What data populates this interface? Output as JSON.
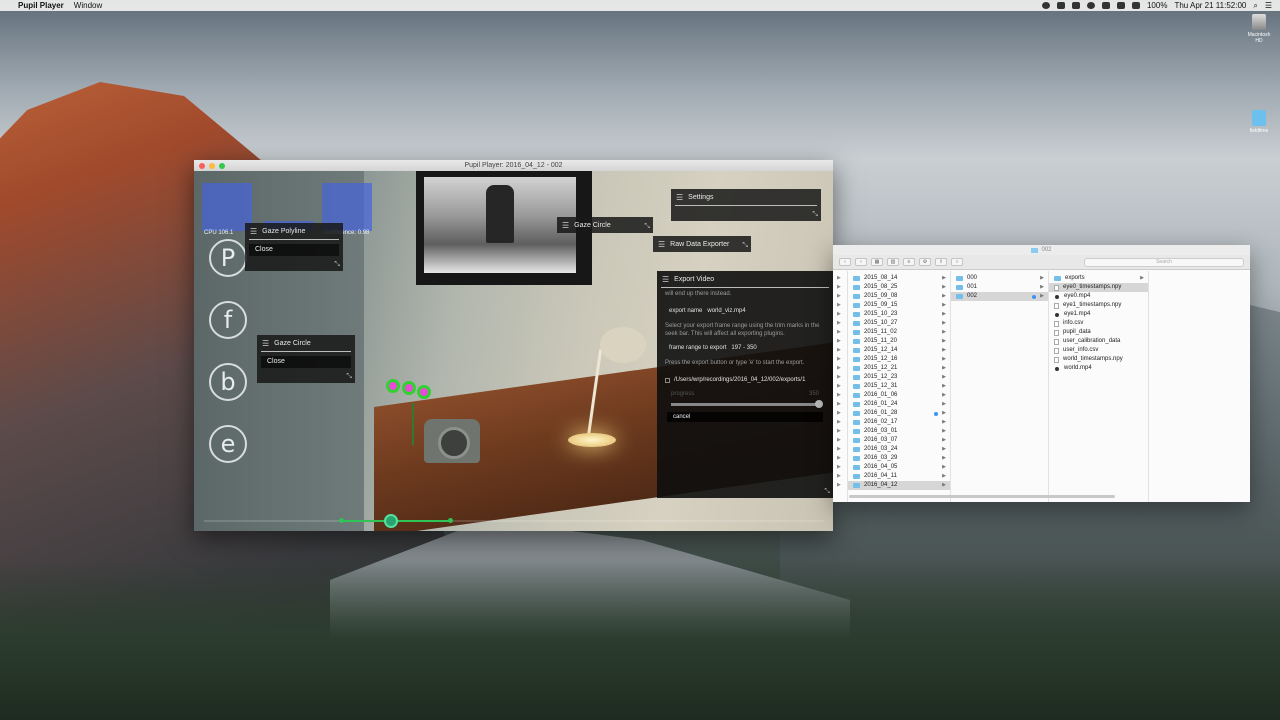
{
  "menubar": {
    "apple": "",
    "app_name": "Pupil Player",
    "items": [
      "Window"
    ],
    "battery": "100%",
    "datetime": "Thu Apr 21  11:52:00"
  },
  "desktop": {
    "hd_label": "Macintosh HD",
    "folder_label": "fieldtime"
  },
  "player": {
    "title": "Pupil Player: 2016_04_12 - 002",
    "cpu_label": "CPU 106.1",
    "conf_label": "Confidence: 0.98",
    "round_buttons": [
      "P",
      "f",
      "b",
      "e"
    ],
    "gaze_polyline": {
      "title": "Gaze Polyline",
      "close": "Close"
    },
    "gaze_circle_1": {
      "title": "Gaze Circle",
      "close": "Close"
    },
    "gaze_circle_2": {
      "title": "Gaze Circle"
    },
    "settings": {
      "title": "Settings"
    },
    "raw_data": {
      "title": "Raw Data Exporter"
    },
    "export_video": {
      "title": "Export Video",
      "trailing_text": "will end up there instead.",
      "export_name_label": "export name",
      "export_name_value": "world_viz.mp4",
      "hint": "Select your export frame range using the trim marks in the seek bar. This will affect all exporting plugins.",
      "frame_range_label": "frame range to export",
      "frame_range_value": "197 - 350",
      "press_hint": "Press the export button or type 'e' to start the export.",
      "path": "/Users/wrp/recordings/2016_04_12/002/exports/1",
      "progress_label": "progress",
      "progress_value": "350",
      "progress_fraction": 1.0,
      "cancel": "cancel"
    }
  },
  "finder": {
    "title": "002",
    "search_placeholder": "Search",
    "col1": [
      "2015_08_14",
      "2015_08_25",
      "2015_09_08",
      "2015_09_15",
      "2015_10_23",
      "2015_10_27",
      "2015_11_02",
      "2015_11_20",
      "2015_12_14",
      "2015_12_16",
      "2015_12_21",
      "2015_12_23",
      "2015_12_31",
      "2016_01_06",
      "2016_01_24",
      "2016_01_28",
      "2016_02_17",
      "2016_03_01",
      "2016_03_07",
      "2016_03_24",
      "2016_03_29",
      "2016_04_05",
      "2016_04_11",
      "2016_04_12"
    ],
    "col2": [
      "000",
      "001",
      "002"
    ],
    "col3": [
      {
        "name": "exports",
        "kind": "folder"
      },
      {
        "name": "eye0_timestamps.npy",
        "kind": "doc"
      },
      {
        "name": "eye0.mp4",
        "kind": "media"
      },
      {
        "name": "eye1_timestamps.npy",
        "kind": "doc"
      },
      {
        "name": "eye1.mp4",
        "kind": "media"
      },
      {
        "name": "info.csv",
        "kind": "doc"
      },
      {
        "name": "pupil_data",
        "kind": "doc"
      },
      {
        "name": "user_calibration_data",
        "kind": "doc"
      },
      {
        "name": "user_info.csv",
        "kind": "doc"
      },
      {
        "name": "world_timestamps.npy",
        "kind": "doc"
      },
      {
        "name": "world.mp4",
        "kind": "media"
      }
    ]
  }
}
